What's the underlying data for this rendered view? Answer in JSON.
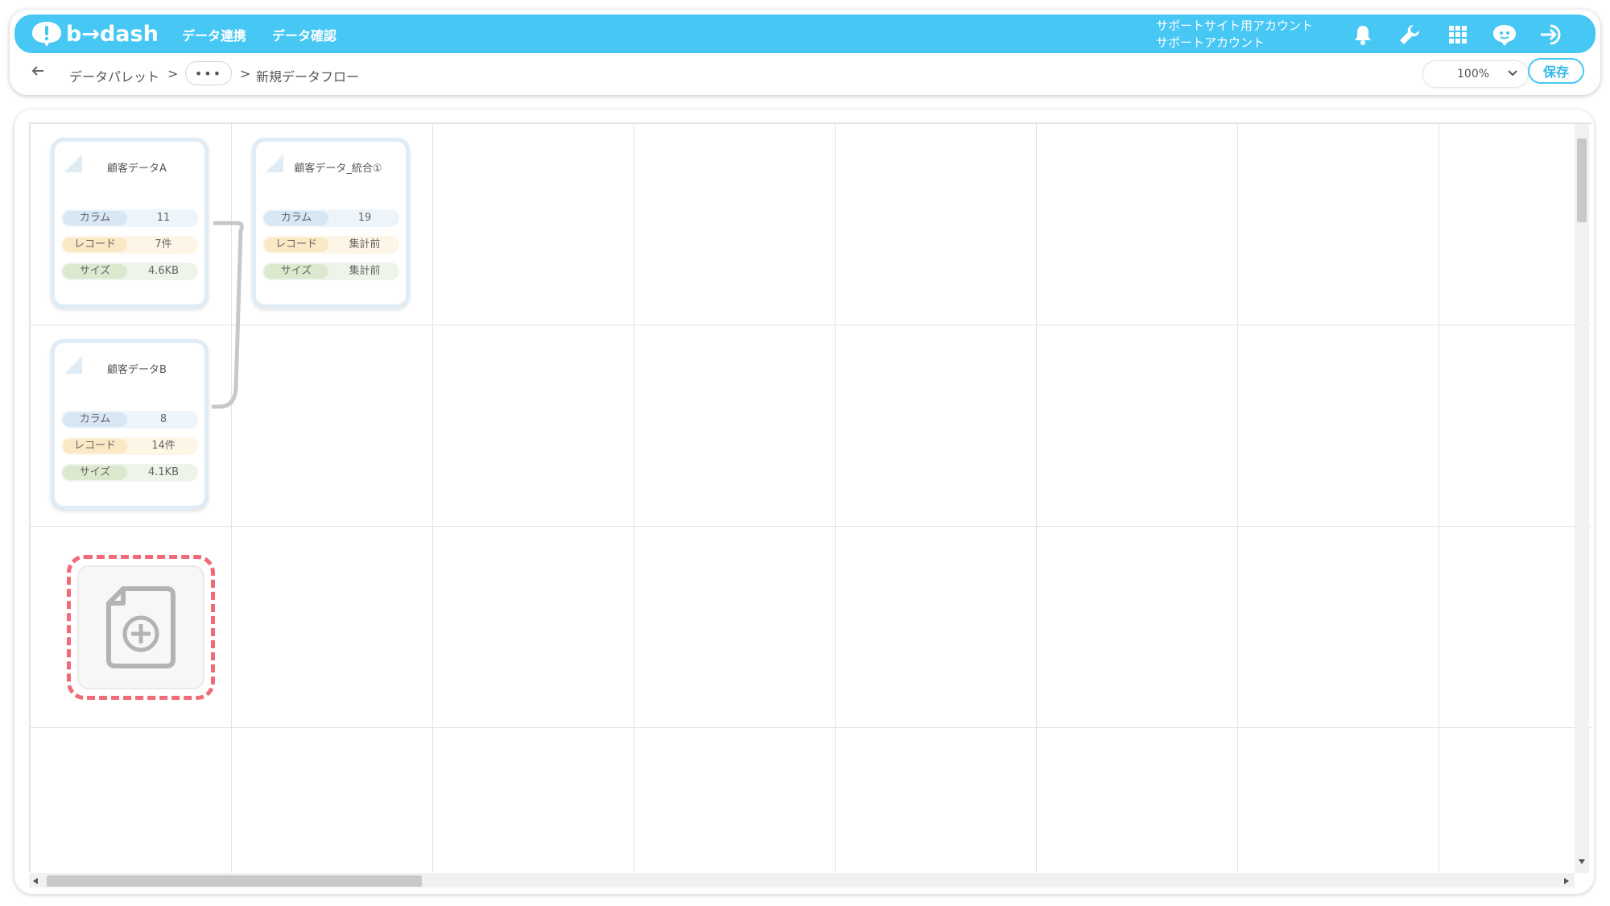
{
  "header": {
    "logo_text": "b→dash",
    "nav": [
      "データ連携",
      "データ確認"
    ],
    "account": {
      "line1": "サポートサイト用アカウント",
      "line2": "サポートアカウント"
    },
    "icons": [
      "bell-icon",
      "wrench-icon",
      "apps-grid-icon",
      "chat-bot-icon",
      "logout-icon"
    ]
  },
  "breadcrumb": {
    "root": "データパレット",
    "sep1": ">",
    "more": "•••",
    "sep2": ">",
    "current": "新規データフロー"
  },
  "toolbar": {
    "zoom": "100%",
    "save_label": "保存"
  },
  "nodes": [
    {
      "title": "顧客データA",
      "rows": [
        {
          "label": "カラム",
          "value": "11"
        },
        {
          "label": "レコード",
          "value": "7件"
        },
        {
          "label": "サイズ",
          "value": "4.6KB"
        }
      ]
    },
    {
      "title": "顧客データ_統合①",
      "rows": [
        {
          "label": "カラム",
          "value": "19"
        },
        {
          "label": "レコード",
          "value": "集計前"
        },
        {
          "label": "サイズ",
          "value": "集計前"
        }
      ]
    },
    {
      "title": "顧客データB",
      "rows": [
        {
          "label": "カラム",
          "value": "8"
        },
        {
          "label": "レコード",
          "value": "14件"
        },
        {
          "label": "サイズ",
          "value": "4.1KB"
        }
      ]
    }
  ],
  "colors": {
    "accent": "#47c7f4",
    "highlight": "#f06a78"
  }
}
